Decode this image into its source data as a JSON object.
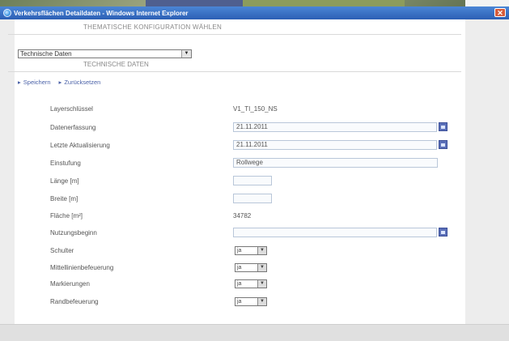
{
  "window": {
    "title": "Verkehrsflächen Detaildaten - Windows Internet Explorer",
    "close_glyph": "✕"
  },
  "config": {
    "header": "THEMATISCHE KONFIGURATION WÄHLEN",
    "selected": "Technische Daten",
    "section_header": "TECHNISCHE DATEN"
  },
  "nav": {
    "save": "Speichern",
    "back": "Zurücksetzen"
  },
  "form": {
    "layer_key": {
      "label": "Layerschlüssel",
      "value": "V1_TI_150_NS"
    },
    "data_capture": {
      "label": "Datenerfassung",
      "value": "21.11.2011"
    },
    "last_update": {
      "label": "Letzte Aktualisierung",
      "value": "21.11.2011"
    },
    "classification": {
      "label": "Einstufung",
      "value": "Rollwege"
    },
    "length": {
      "label": "Länge [m]",
      "value": ""
    },
    "width": {
      "label": "Breite [m]",
      "value": ""
    },
    "area": {
      "label": "Fläche [m²]",
      "value": "34782"
    },
    "usage_start": {
      "label": "Nutzungsbeginn",
      "value": ""
    },
    "shoulder": {
      "label": "Schulter",
      "value": "ja"
    },
    "centerline_lighting": {
      "label": "Mittellinienbefeuerung",
      "value": "ja"
    },
    "markings": {
      "label": "Markierungen",
      "value": "ja"
    },
    "edge_lighting": {
      "label": "Randbefeuerung",
      "value": "ja"
    }
  }
}
